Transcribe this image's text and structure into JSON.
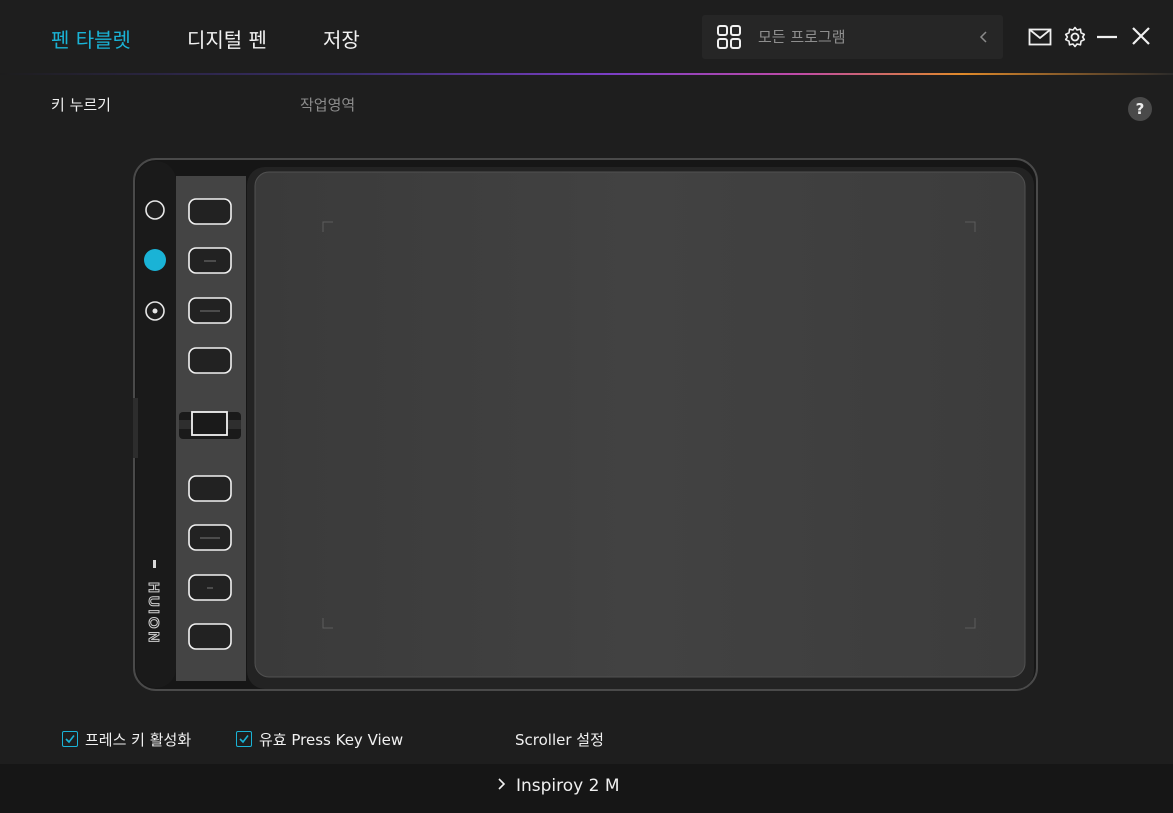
{
  "nav": {
    "tabs": [
      {
        "label": "펜 타블렛",
        "active": true
      },
      {
        "label": "디지털 펜",
        "active": false
      },
      {
        "label": "저장",
        "active": false
      }
    ],
    "accent_color": "#1ab3d6"
  },
  "search": {
    "icon": "grid-icon",
    "placeholder": "모든 프로그램",
    "back_icon": "chevron-left-icon"
  },
  "window_controls": {
    "icons": [
      "mail-icon",
      "gear-icon",
      "minimize-icon",
      "close-icon"
    ]
  },
  "subtabs": [
    {
      "label": "키 누르기",
      "active": true
    },
    {
      "label": "작업영역",
      "active": false
    }
  ],
  "help": {
    "label": "?"
  },
  "tablet": {
    "brand": "HUION",
    "mode_indicators": [
      {
        "state": "off"
      },
      {
        "state": "active"
      },
      {
        "state": "off-dot"
      }
    ],
    "express_key_count": 8,
    "active_indicator_color": "#1ab3d6"
  },
  "options": {
    "press_key_enable": {
      "label": "프레스 키 활성화",
      "checked": true
    },
    "press_key_view": {
      "label": "유효 Press Key View",
      "checked": true
    },
    "scroller_settings": {
      "label": "Scroller 설정"
    }
  },
  "device": {
    "icon": "chevron-right-icon",
    "name": "Inspiroy 2 M"
  }
}
